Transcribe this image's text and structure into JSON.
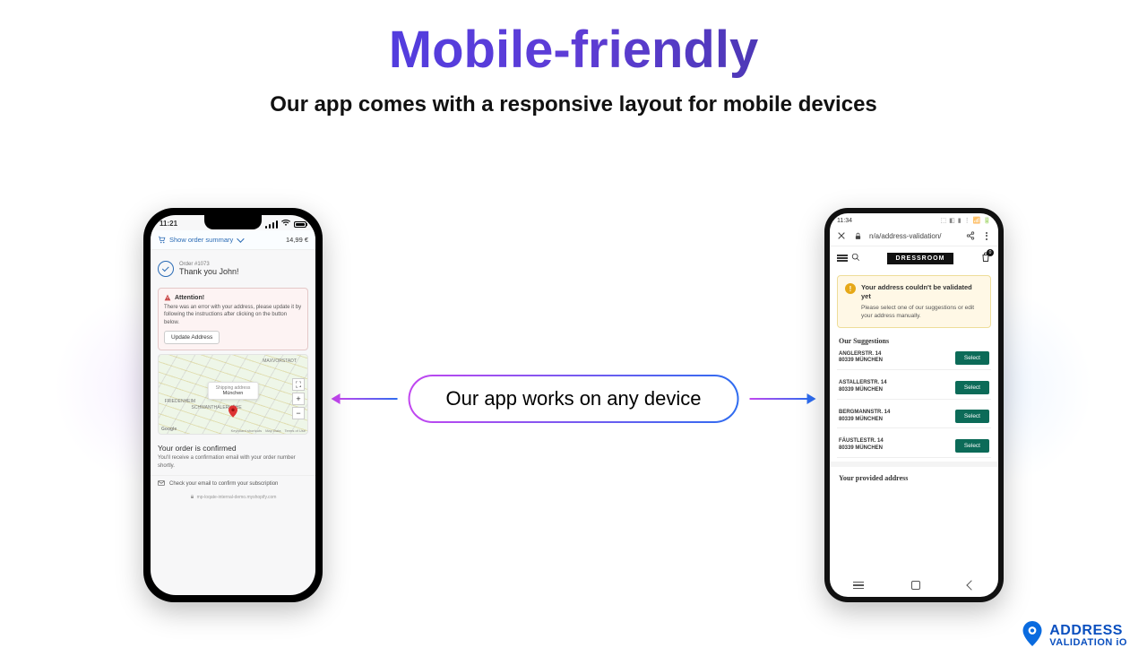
{
  "header": {
    "title": "Mobile-friendly",
    "subtitle": "Our app comes with a responsive layout for mobile devices"
  },
  "center": {
    "label": "Our app works on any device"
  },
  "iphone": {
    "time": "11:21",
    "summary_label": "Show order summary",
    "summary_total": "14,99 €",
    "order_id": "Order #1073",
    "thank_you": "Thank you John!",
    "alert_title": "Attention!",
    "alert_body": "There was an error with your address, please update it by following the instructions after clicking on the button below.",
    "update_btn": "Update Address",
    "map": {
      "tooltip_title": "Shipping address",
      "tooltip_value": "München",
      "label1": "MAXVORSTADT",
      "label2": "SCHWANTHALERHÖHE",
      "label0": "FRIEDENHEIM",
      "footer1": "Keyboard shortcuts",
      "footer2": "Map Data",
      "footer3": "Terms of Use",
      "google": "Google"
    },
    "confirmed_title": "Your order is confirmed",
    "confirmed_body": "You'll receive a confirmation email with your order number shortly.",
    "mail_line": "Check your email to confirm your subscription",
    "domain": "mp-loqate-internal-demo.myshopify.com"
  },
  "android": {
    "time": "11:34",
    "url": "n/a/address-validation/",
    "shop_name": "DRESSROOM",
    "bag_count": "0",
    "warn_title": "Your address couldn't be validated yet",
    "warn_body": "Please select one of our suggestions or edit your address manually.",
    "suggestions_header": "Our Suggestions",
    "suggestions": [
      {
        "line1": "ANGLERSTR. 14",
        "line2": "80339 MÜNCHEN"
      },
      {
        "line1": "ASTALLERSTR. 14",
        "line2": "80339 MÜNCHEN"
      },
      {
        "line1": "BERGMANNSTR. 14",
        "line2": "80339 MÜNCHEN"
      },
      {
        "line1": "FÄUSTLESTR. 14",
        "line2": "80339 MÜNCHEN"
      }
    ],
    "select_label": "Select",
    "provided_header": "Your provided address"
  },
  "brand": {
    "line1": "ADDRESS",
    "line2": "VALIDATION iO"
  }
}
